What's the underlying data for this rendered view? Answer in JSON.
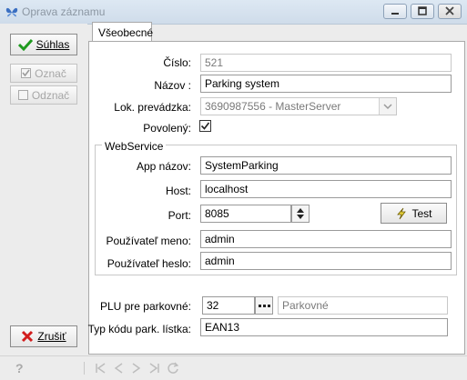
{
  "window": {
    "title": "Oprava záznamu"
  },
  "sidebar": {
    "confirm_label": "Súhlas",
    "mark_label": "Označ",
    "unmark_label": "Odznač",
    "cancel_label": "Zrušiť"
  },
  "tabs": [
    {
      "label": "Všeobecné"
    }
  ],
  "form": {
    "cislo": {
      "label": "Číslo:",
      "value": "521"
    },
    "nazov": {
      "label": "Názov :",
      "value": "Parking system"
    },
    "prevadzka": {
      "label": "Lok. prevádzka:",
      "value": "3690987556 - MasterServer"
    },
    "povoleny": {
      "label": "Povolený:",
      "checked": true
    }
  },
  "webservice": {
    "group_label": "WebService",
    "app_name": {
      "label": "App názov:",
      "value": "SystemParking"
    },
    "host": {
      "label": "Host:",
      "value": "localhost"
    },
    "port": {
      "label": "Port:",
      "value": "8085"
    },
    "test_label": "Test",
    "user": {
      "label": "Používateľ meno:",
      "value": "admin"
    },
    "password": {
      "label": "Používateľ heslo:",
      "value": "admin"
    }
  },
  "parking": {
    "plu": {
      "label": "PLU pre parkovné:",
      "value": "32",
      "description": "Parkovné"
    },
    "ticket_type": {
      "label": "Typ kódu park. lístka:",
      "value": "EAN13"
    }
  },
  "icons": [
    "butterfly-icon",
    "minimize-icon",
    "maximize-icon",
    "close-icon",
    "checkmark-icon",
    "red-x-icon",
    "help-icon",
    "nav-first-icon",
    "nav-prev-icon",
    "nav-next-icon",
    "nav-last-icon",
    "refresh-icon",
    "spinner-icon",
    "ellipsis-icon",
    "dropdown-icon",
    "lightning-icon"
  ]
}
